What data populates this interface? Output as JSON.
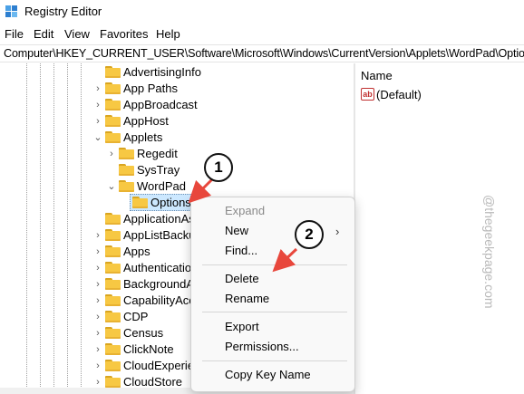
{
  "window": {
    "title": "Registry Editor",
    "app_icon": "registry-editor-icon"
  },
  "menu": [
    "File",
    "Edit",
    "View",
    "Favorites",
    "Help"
  ],
  "address": "Computer\\HKEY_CURRENT_USER\\Software\\Microsoft\\Windows\\CurrentVersion\\Applets\\WordPad\\Options",
  "tree": [
    {
      "label": "AdvertisingInfo",
      "chevron": ""
    },
    {
      "label": "App Paths",
      "chevron": "›"
    },
    {
      "label": "AppBroadcast",
      "chevron": "›"
    },
    {
      "label": "AppHost",
      "chevron": "›"
    },
    {
      "label": "Applets",
      "chevron": "⌄"
    },
    {
      "label": "Regedit",
      "chevron": "›"
    },
    {
      "label": "SysTray",
      "chevron": ""
    },
    {
      "label": "WordPad",
      "chevron": "⌄"
    },
    {
      "label": "Options",
      "chevron": "",
      "selected": true
    },
    {
      "label": "ApplicationAs",
      "chevron": ""
    },
    {
      "label": "AppListBacku",
      "chevron": "›"
    },
    {
      "label": "Apps",
      "chevron": "›"
    },
    {
      "label": "Authentication",
      "chevron": "›"
    },
    {
      "label": "BackgroundA",
      "chevron": "›"
    },
    {
      "label": "CapabilityAcc",
      "chevron": "›"
    },
    {
      "label": "CDP",
      "chevron": "›"
    },
    {
      "label": "Census",
      "chevron": "›"
    },
    {
      "label": "ClickNote",
      "chevron": "›"
    },
    {
      "label": "CloudExperien",
      "chevron": "›"
    },
    {
      "label": "CloudStore",
      "chevron": "›"
    }
  ],
  "values_pane": {
    "column_name": "Name",
    "rows": [
      {
        "icon": "string-value-icon",
        "icon_text": "ab",
        "name": "(Default)"
      }
    ]
  },
  "context_menu": {
    "items": [
      "Expand",
      "New",
      "Find...",
      "Delete",
      "Rename",
      "Export",
      "Permissions...",
      "Copy Key Name"
    ],
    "disabled": [
      "Expand"
    ],
    "submenu_arrow": "›"
  },
  "annotations": {
    "step1": "1",
    "step2": "2",
    "arrow_color": "#e8473c"
  },
  "watermark": "@thegeekpage.com",
  "colors": {
    "selection": "#cce8ff",
    "folder": "#f7c843"
  }
}
